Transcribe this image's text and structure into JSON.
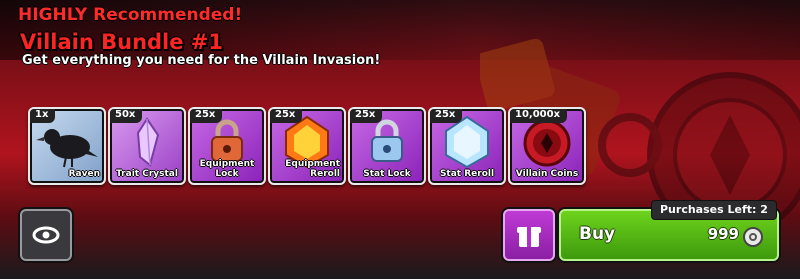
{
  "bundle": {
    "tag": "HIGHLY Recommended!",
    "title": "Villain Bundle #1",
    "subtitle": "Get everything you need for the Villain Invasion!"
  },
  "items": [
    {
      "qty": "1x",
      "label": "Raven",
      "icon": "raven-icon",
      "bg": "#9db8d8"
    },
    {
      "qty": "50x",
      "label": "Trait Crystal",
      "icon": "trait-crystal-icon",
      "bg": "#b56ad6"
    },
    {
      "qty": "25x",
      "label": "Equipment Lock",
      "icon": "equipment-lock-icon",
      "bg": "#b24ad8"
    },
    {
      "qty": "25x",
      "label": "Equipment Reroll",
      "icon": "equipment-reroll-icon",
      "bg": "#b24ad8"
    },
    {
      "qty": "25x",
      "label": "Stat Lock",
      "icon": "stat-lock-icon",
      "bg": "#b24ad8"
    },
    {
      "qty": "25x",
      "label": "Stat Reroll",
      "icon": "stat-reroll-icon",
      "bg": "#b24ad8"
    },
    {
      "qty": "10,000x",
      "label": "Villain Coins",
      "icon": "villain-coins-icon",
      "bg": "#b24ad8"
    }
  ],
  "actions": {
    "preview_icon": "eye-icon",
    "gift_icon": "gift-icon",
    "buy_label": "Buy",
    "price": "999",
    "currency_icon": "coin-icon",
    "purchases_left": "Purchases Left: 2"
  },
  "colors": {
    "title_red": "#ff2424",
    "buy_green": "#4fb514",
    "gift_purple": "#b030c8"
  }
}
